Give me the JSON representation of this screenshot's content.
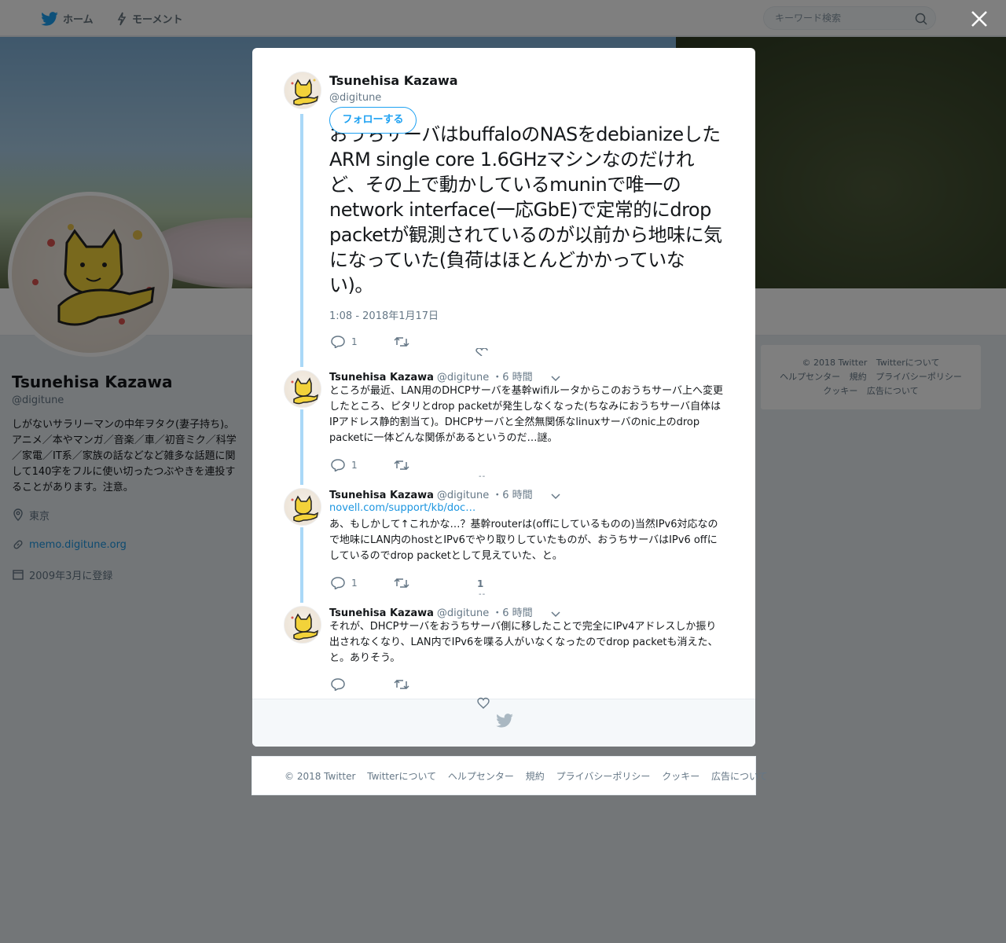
{
  "topbar": {
    "home_label": "ホーム",
    "moments_label": "モーメント",
    "search_placeholder": "キーワード検索"
  },
  "profile": {
    "name": "Tsunehisa Kazawa",
    "handle": "@digitune",
    "bio": "しがないサラリーマンの中年ヲタク(妻子持ち)。アニメ／本やマンガ／音楽／車／初音ミク／科学／家電／IT系／家族の話などなど雑多な話題に関して140字をフルに使い切ったつぶやきを連投することがあります。注意。",
    "location": "東京",
    "url": "memo.digitune.org",
    "joined": "2009年3月に登録"
  },
  "right_footer": {
    "links": [
      "© 2018 Twitter",
      "Twitterについて",
      "ヘルプセンター",
      "規約",
      "プライバシーポリシー",
      "クッキー",
      "広告について"
    ]
  },
  "main_tweet": {
    "name": "Tsunehisa Kazawa",
    "handle": "@digitune",
    "follow_label": "フォローする",
    "text": "おうちサーバはbuffaloのNASをdebianizeしたARM single core 1.6GHzマシンなのだけれど、その上で動かしているmuninで唯一のnetwork interface(一応GbE)で定常的にdrop packetが観測されているのが以前から地味に気になっていた(負荷はほとんどかかっていない)。",
    "time": "1:08 - 2018年1月17日",
    "reply_count": "1"
  },
  "replies": [
    {
      "name": "Tsunehisa Kazawa",
      "handle": "@digitune",
      "time": "・6 時間",
      "text": "ところが最近、LAN用のDHCPサーバを基幹wifiルータからこのおうちサーバ上へ変更したところ、ピタリとdrop packetが発生しなくなった(ちなみにおうちサーバ自体はIPアドレス静的割当て)。DHCPサーバと全然無関係なlinuxサーバのnic上のdrop packetに一体どんな関係があるというのだ…謎。",
      "reply_count": "1"
    },
    {
      "name": "Tsunehisa Kazawa",
      "handle": "@digitune",
      "time": "・6 時間",
      "link": "novell.com/support/kb/doc…",
      "text": "あ、もしかして↑これかな…？基幹routerは(offにしているものの)当然IPv6対応なので地味にLAN内のhostとIPv6でやり取りしていたものが、おうちサーバはIPv6 offにしているのでdrop packetとして見えていた、と。",
      "reply_count": "1",
      "like_count": "1"
    },
    {
      "name": "Tsunehisa Kazawa",
      "handle": "@digitune",
      "time": "・6 時間",
      "text": "それが、DHCPサーバをおうちサーバ側に移したことで完全にIPv4アドレスしか振り出されなくなり、LAN内でIPv6を喋る人がいなくなったのでdrop packetも消えた、と。ありそう。"
    }
  ],
  "bottom_footer": {
    "links": [
      "© 2018 Twitter",
      "Twitterについて",
      "ヘルプセンター",
      "規約",
      "プライバシーポリシー",
      "クッキー",
      "広告について"
    ]
  },
  "colors": {
    "accent": "#1da1f2",
    "thread_line": "#aad8f7",
    "muted": "#657786"
  }
}
